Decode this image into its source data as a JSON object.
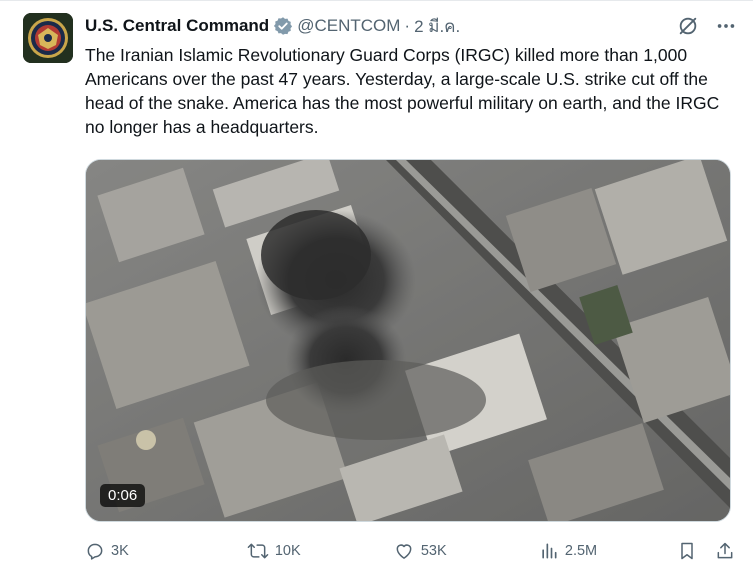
{
  "tweet": {
    "author_name": "U.S. Central Command",
    "handle": "@CENTCOM",
    "separator": "·",
    "timestamp": "2 มี.ค.",
    "text": "The Iranian Islamic Revolutionary Guard Corps (IRGC) killed more than 1,000 Americans over the past 47 years. Yesterday, a large-scale U.S. strike cut off the head of the snake. America has the most powerful military on earth, and the IRGC no longer has a headquarters.",
    "video_duration": "0:06"
  },
  "actions": {
    "replies": "3K",
    "reposts": "10K",
    "likes": "53K",
    "views": "2.5M"
  },
  "colors": {
    "text": "#0f1419",
    "secondary": "#536471",
    "verified_badge": "#829aab",
    "border": "#cfd9de"
  },
  "icons": {
    "verified": "verified-badge-icon",
    "grok": "grok-icon",
    "more": "more-icon",
    "reply": "reply-icon",
    "repost": "repost-icon",
    "like": "like-icon",
    "views": "views-icon",
    "bookmark": "bookmark-icon",
    "share": "share-icon"
  }
}
